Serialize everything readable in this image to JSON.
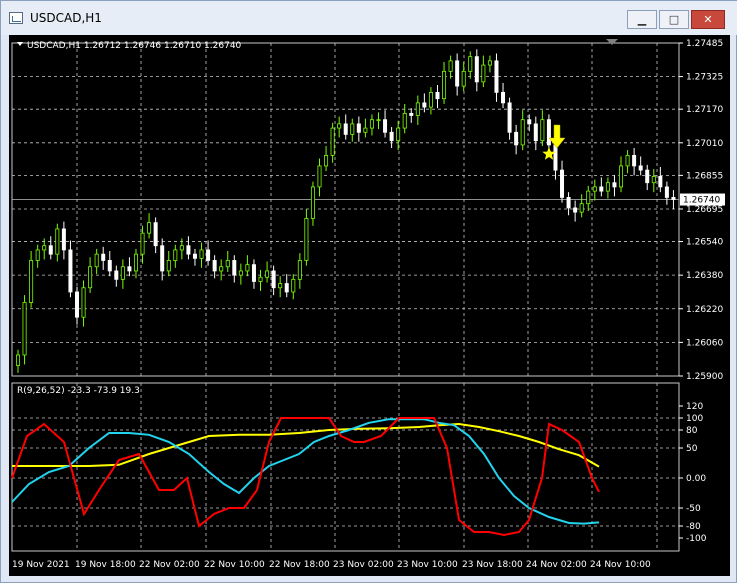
{
  "window": {
    "title": "USDCAD,H1",
    "minimize_glyph": "▁",
    "maximize_glyph": "□",
    "close_glyph": "✕"
  },
  "chart": {
    "symbol_header": "USDCAD,H1  1.26712 1.26746 1.26710 1.26740",
    "current_price_label": "1.26740",
    "price_ticks": [
      "1.27485",
      "1.27325",
      "1.27170",
      "1.27010",
      "1.26855",
      "1.26695",
      "1.26540",
      "1.26380",
      "1.26220",
      "1.26060",
      "1.25900"
    ],
    "time_ticks": [
      "19 Nov 2021",
      "19 Nov 18:00",
      "22 Nov 02:00",
      "22 Nov 10:00",
      "22 Nov 18:00",
      "23 Nov 02:00",
      "23 Nov 10:00",
      "23 Nov 18:00",
      "24 Nov 02:00",
      "24 Nov 10:00"
    ],
    "indicator_header": "R(9,26,52) -23.3 -73.9 19.3",
    "indicator_ticks": [
      "120",
      "100",
      "80",
      "50",
      "0.00",
      "-50",
      "-80",
      "-100"
    ],
    "colors": {
      "background": "#000000",
      "grid": "#c8c8c8",
      "bull_candle": "#7cfc00",
      "bear_candle": "#ffffff",
      "line_fast": "#ff0000",
      "line_mid": "#22d3ee",
      "line_slow": "#ffff00",
      "marker": "#ffff00"
    },
    "annotations": [
      "star-marker",
      "arrow-down-marker"
    ]
  }
}
